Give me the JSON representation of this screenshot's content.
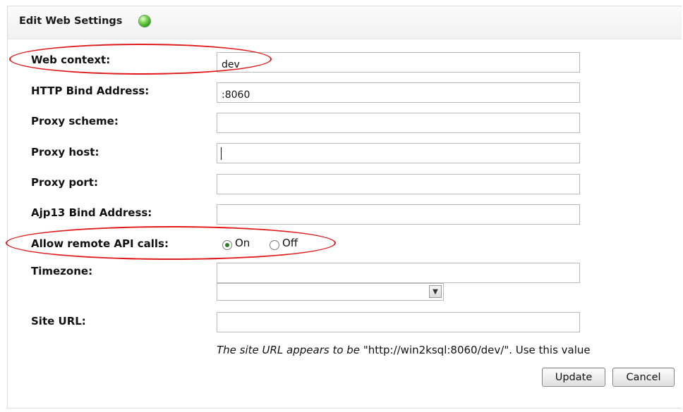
{
  "panel": {
    "title": "Edit Web Settings",
    "status_icon": "green-status-icon"
  },
  "form": {
    "web_context": {
      "label": "Web context:",
      "value": "dev"
    },
    "http_bind_address": {
      "label": "HTTP Bind Address:",
      "value": ":8060"
    },
    "proxy_scheme": {
      "label": "Proxy scheme:",
      "value": ""
    },
    "proxy_host": {
      "label": "Proxy host:",
      "value": ""
    },
    "proxy_port": {
      "label": "Proxy port:",
      "value": ""
    },
    "ajp13_bind_address": {
      "label": "Ajp13 Bind Address:",
      "value": ""
    },
    "allow_remote_api": {
      "label": "Allow remote API calls:",
      "options": [
        "On",
        "Off"
      ],
      "selected": "On"
    },
    "timezone": {
      "label": "Timezone:",
      "value": "",
      "select_value": ""
    },
    "site_url": {
      "label": "Site URL:",
      "value": ""
    }
  },
  "hint": {
    "prefix": "The site URL appears to be",
    "url": "\"http://win2ksql:8060/dev/\". Use this value"
  },
  "buttons": {
    "update": "Update",
    "cancel": "Cancel"
  },
  "colors": {
    "highlight": "#e01a1a",
    "status": "#3aa524"
  }
}
